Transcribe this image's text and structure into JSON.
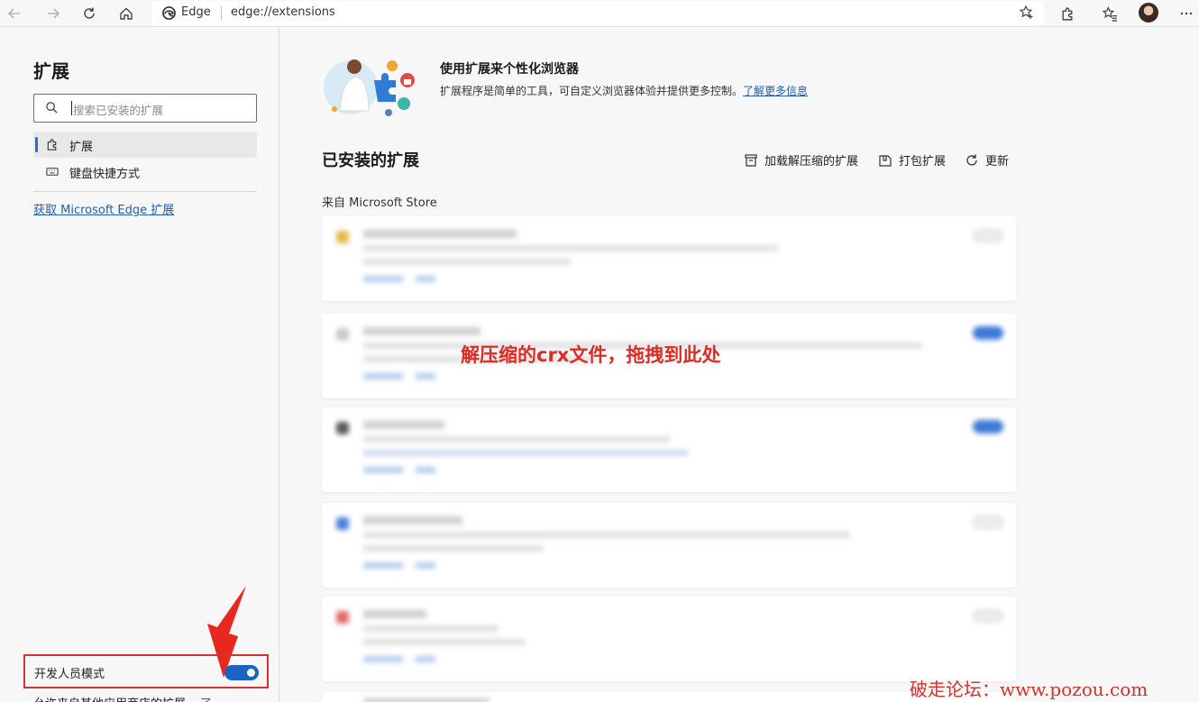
{
  "browser": {
    "address_brand": "Edge",
    "address_url": "edge://extensions"
  },
  "sidebar": {
    "title": "扩展",
    "search_placeholder": "搜索已安装的扩展",
    "nav": [
      {
        "label": "扩展"
      },
      {
        "label": "键盘快捷方式"
      }
    ],
    "get_link": "获取 Microsoft Edge 扩展",
    "developer_mode_label": "开发人员模式",
    "developer_mode": true,
    "allow_other_label": "允许来自其他应用商店的扩展。",
    "allow_other_link": "了"
  },
  "main": {
    "hero_title": "使用扩展来个性化浏览器",
    "hero_desc": "扩展程序是简单的工具，可自定义浏览器体验并提供更多控制。",
    "hero_link": "了解更多信息",
    "installed_title": "已安装的扩展",
    "actions": {
      "load_unpacked": "加载解压缩的扩展",
      "pack": "打包扩展",
      "update": "更新"
    },
    "source_label": "来自 Microsoft Store",
    "overlay_annotation": "解压缩的crx文件，拖拽到此处"
  },
  "watermark": "破走论坛：www.pozou.com",
  "colors": {
    "accent": "#1a65c4",
    "link": "#1f5fb0",
    "annotation_red": "#e02a23"
  }
}
